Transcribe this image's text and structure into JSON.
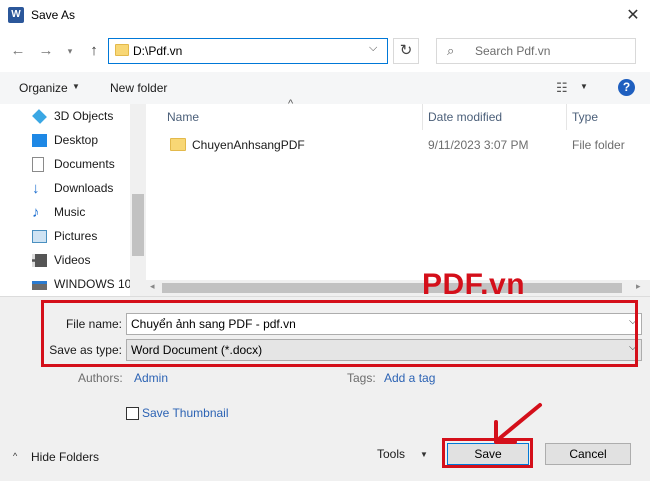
{
  "window": {
    "app_icon": "W",
    "title": "Save As",
    "close_glyph": "✕"
  },
  "nav": {
    "back_glyph": "←",
    "forward_glyph": "→",
    "recent_glyph": "▾",
    "up_glyph": "↑",
    "address": "D:\\Pdf.vn",
    "address_chevron": "⌵",
    "refresh_glyph": "↻",
    "search_placeholder": "Search Pdf.vn",
    "search_glyph": "⌕"
  },
  "toolbar": {
    "organize": "Organize",
    "new_folder": "New folder",
    "caret": "▼",
    "view_glyph": "☷",
    "help": "?"
  },
  "sidebar": {
    "items": [
      {
        "label": "3D Objects",
        "icon": "cube-icon",
        "color": "#3aa7e4"
      },
      {
        "label": "Desktop",
        "icon": "desktop-icon",
        "color": "#1e88e5"
      },
      {
        "label": "Documents",
        "icon": "documents-icon",
        "color": "#8a8a8a"
      },
      {
        "label": "Downloads",
        "icon": "download-icon",
        "color": "#1e6fd0"
      },
      {
        "label": "Music",
        "icon": "music-icon",
        "color": "#1e6fd0"
      },
      {
        "label": "Pictures",
        "icon": "pictures-icon",
        "color": "#4a90c0"
      },
      {
        "label": "Videos",
        "icon": "videos-icon",
        "color": "#555555"
      },
      {
        "label": "WINDOWS 10",
        "icon": "drive-icon",
        "color": "#6b6b6b"
      }
    ]
  },
  "file_list": {
    "columns": [
      "Name",
      "Date modified",
      "Type"
    ],
    "sort_glyph": "^",
    "rows": [
      {
        "name": "ChuyenAnhsangPDF",
        "date": "9/11/2023 3:07 PM",
        "type": "File folder"
      }
    ]
  },
  "form": {
    "file_name_label": "File name:",
    "file_name_value": "Chuyển ảnh sang PDF - pdf.vn",
    "save_type_label": "Save as type:",
    "save_type_value": "Word Document (*.docx)",
    "chevron": "⌵",
    "authors_label": "Authors:",
    "authors_value": "Admin",
    "tags_label": "Tags:",
    "tags_value": "Add a tag",
    "save_thumbnail": "Save Thumbnail"
  },
  "footer": {
    "hide_folders": "Hide Folders",
    "hide_caret": "^",
    "tools": "Tools",
    "tools_caret": "▼",
    "save": "Save",
    "cancel": "Cancel"
  },
  "annotation": {
    "brand": "PDF.vn",
    "highlight_color": "#d40f1a"
  }
}
